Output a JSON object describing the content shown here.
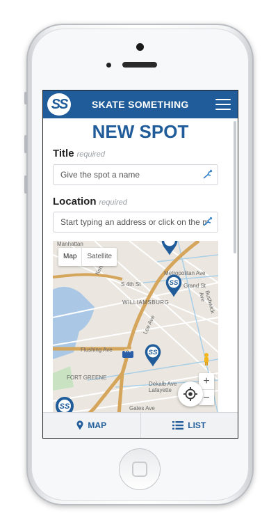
{
  "app": {
    "brand": "SKATE SOMETHING",
    "logo_text": "SS"
  },
  "page": {
    "title": "NEW SPOT"
  },
  "form": {
    "title_label": "Title",
    "title_required": "required",
    "title_placeholder": "Give the spot a name",
    "location_label": "Location",
    "location_required": "required",
    "location_placeholder": "Start typing an address or click on the m"
  },
  "map": {
    "type_buttons": [
      "Map",
      "Satellite"
    ],
    "zoom_in": "+",
    "zoom_out": "−",
    "labels": [
      "Williamsburg",
      "Metropolitan Ave",
      "Grand St",
      "S 4th St",
      "Kent Ave",
      "Flushing Ave",
      "Fort Greene",
      "Dekalb Ave",
      "Lafayette",
      "Gates Ave",
      "Lee Ave",
      "Bushwick Ave",
      "278",
      "Manhattan"
    ],
    "marker_text": "SS"
  },
  "tabbar": {
    "map_label": "MAP",
    "list_label": "LIST"
  },
  "colors": {
    "brand_blue": "#1f5c99",
    "road_orange": "#d4a55a"
  }
}
